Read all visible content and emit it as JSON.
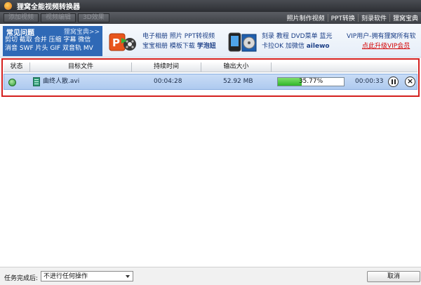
{
  "window": {
    "title": "狸窝全能视频转换器"
  },
  "toolbar": {
    "buttons": [
      "添加视频",
      "视频编辑",
      "3D效果"
    ],
    "links": [
      "照片制作视频",
      "PPT转换",
      "刻录软件",
      "狸窝宝典"
    ]
  },
  "banner": {
    "faq_title": "常见问题",
    "faq_more": "狸窝宝典>>",
    "faq_rows": [
      "剪切 截取 合并 压缩 字幕 微信",
      "消音 SWF 片头 GIF 双音轨 MV"
    ],
    "group1_line1": "电子相册 照片 PPT转视频",
    "group1_line2a": "宝宝相册 模板下载",
    "group1_line2b": "学泡妞",
    "group2_line1": "刻录 教程 DVD菜单 蓝光",
    "group2_line2a": "卡拉OK 加微信",
    "group2_line2b": "ailewo",
    "vip_line": "VIP用户-拥有狸窝所有软",
    "vip_link": "点此升级VIP会员"
  },
  "table": {
    "columns": [
      "状态",
      "目标文件",
      "持续时间",
      "输出大小"
    ],
    "rows": [
      {
        "file": "曲终人散.avi",
        "duration": "00:04:28",
        "size": "52.92 MB",
        "progress_label": "35.77%",
        "progress": 0.3577,
        "remaining": "00:00:33"
      }
    ]
  },
  "bottom": {
    "after_label": "任务完成后:",
    "after_value": "不进行任何操作",
    "cancel": "取消"
  },
  "colors": {
    "accent": "#2f69b6",
    "highlight_frame": "#d4201e",
    "progress": "#2fb52a"
  }
}
